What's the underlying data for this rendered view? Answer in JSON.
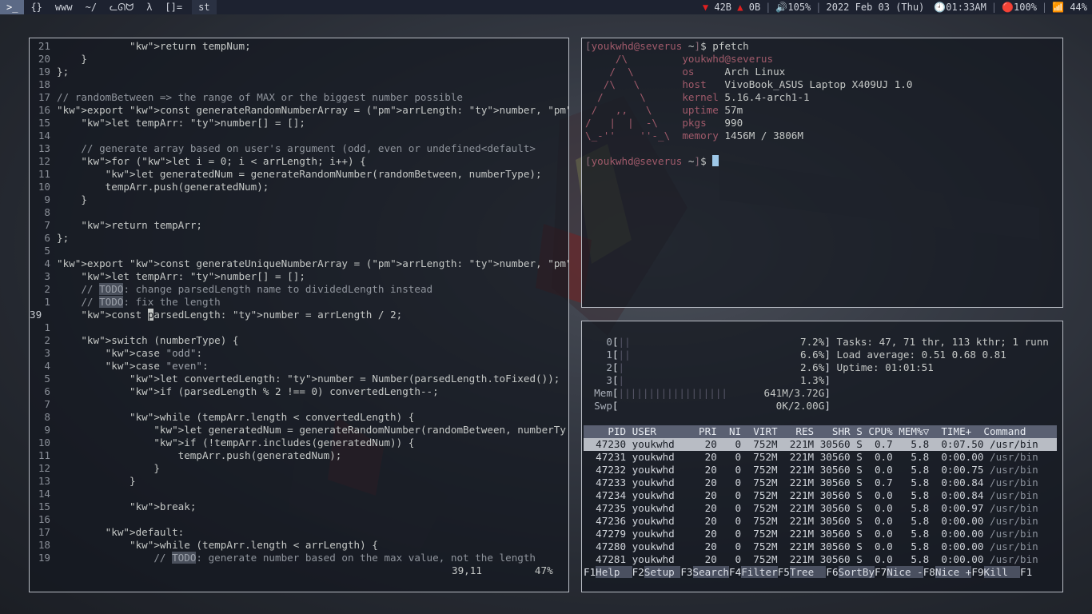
{
  "bar": {
    "launcher": ">_",
    "tags": [
      "{}",
      "www",
      "~/",
      "ᓚᘏᗢ",
      "λ",
      "[]="
    ],
    "window_title": "st",
    "net_down": "42B",
    "net_up": "0B",
    "volume": "🔊105%",
    "date": "2022 Feb 03 (Thu)",
    "time": "🕘01:33AM",
    "battery": "🔴100%",
    "wifi": "📶 44%"
  },
  "editor": {
    "lines": [
      {
        "n": "21",
        "t": "            return tempNum;"
      },
      {
        "n": "20",
        "t": "    }"
      },
      {
        "n": "19",
        "t": "};"
      },
      {
        "n": "18",
        "t": ""
      },
      {
        "n": "17",
        "t": "// randomBetween => the range of MAX or the biggest number possible"
      },
      {
        "n": "16",
        "t": "export const generateRandomNumberArray = (arrLength: number, randomBetween: num"
      },
      {
        "n": "15",
        "t": "    let tempArr: number[] = [];"
      },
      {
        "n": "14",
        "t": ""
      },
      {
        "n": "13",
        "t": "    // generate array based on user's argument (odd, even or undefined<default>"
      },
      {
        "n": "12",
        "t": "    for (let i = 0; i < arrLength; i++) {"
      },
      {
        "n": "11",
        "t": "        let generatedNum = generateRandomNumber(randomBetween, numberType);"
      },
      {
        "n": "10",
        "t": "        tempArr.push(generatedNum);"
      },
      {
        "n": "9",
        "t": "    }"
      },
      {
        "n": "8",
        "t": ""
      },
      {
        "n": "7",
        "t": "    return tempArr;"
      },
      {
        "n": "6",
        "t": "};"
      },
      {
        "n": "5",
        "t": ""
      },
      {
        "n": "4",
        "t": "export const generateUniqueNumberArray = (arrLength: number, randomBetween: num"
      },
      {
        "n": "3",
        "t": "    let tempArr: number[] = [];"
      },
      {
        "n": "2",
        "t": "    // TODO: change parsedLength name to dividedLength instead"
      },
      {
        "n": "1",
        "t": "    // TODO: fix the length"
      },
      {
        "n": "39",
        "t": "    const parsedLength: number = arrLength / 2;"
      },
      {
        "n": "1",
        "t": ""
      },
      {
        "n": "2",
        "t": "    switch (numberType) {"
      },
      {
        "n": "3",
        "t": "        case \"odd\":"
      },
      {
        "n": "4",
        "t": "        case \"even\":"
      },
      {
        "n": "5",
        "t": "            let convertedLength: number = Number(parsedLength.toFixed());"
      },
      {
        "n": "6",
        "t": "            if (parsedLength % 2 !== 0) convertedLength--;"
      },
      {
        "n": "7",
        "t": ""
      },
      {
        "n": "8",
        "t": "            while (tempArr.length < convertedLength) {"
      },
      {
        "n": "9",
        "t": "                let generatedNum = generateRandomNumber(randomBetween, numberTy"
      },
      {
        "n": "10",
        "t": "                if (!tempArr.includes(generatedNum)) {"
      },
      {
        "n": "11",
        "t": "                    tempArr.push(generatedNum);"
      },
      {
        "n": "12",
        "t": "                }"
      },
      {
        "n": "13",
        "t": "            }"
      },
      {
        "n": "14",
        "t": ""
      },
      {
        "n": "15",
        "t": "            break;"
      },
      {
        "n": "16",
        "t": ""
      },
      {
        "n": "17",
        "t": "        default:"
      },
      {
        "n": "18",
        "t": "            while (tempArr.length < arrLength) {"
      },
      {
        "n": "19",
        "t": "                // TODO: generate number based on the max value, not the length"
      }
    ],
    "status_pos": "39,11",
    "status_pct": "47%"
  },
  "term": {
    "prompt_user": "youkwhd@severus",
    "prompt_dir": "~",
    "cmd": "pfetch",
    "art": [
      "     /\\",
      "    /  \\",
      "   /\\   \\",
      "  /      \\",
      " /   ,,   \\",
      "/   |  |  -\\",
      "\\_-''    ''-_\\"
    ],
    "title": "youkwhd@severus",
    "info": [
      {
        "k": "os",
        "v": "Arch Linux"
      },
      {
        "k": "host",
        "v": "VivoBook_ASUS Laptop X409UJ 1.0"
      },
      {
        "k": "kernel",
        "v": "5.16.4-arch1-1"
      },
      {
        "k": "uptime",
        "v": "57m"
      },
      {
        "k": "pkgs",
        "v": "990"
      },
      {
        "k": "memory",
        "v": "1456M / 3806M"
      }
    ]
  },
  "htop": {
    "cpus": [
      {
        "id": "0",
        "pct": "7.2%",
        "fill": 0.072
      },
      {
        "id": "1",
        "pct": "6.6%",
        "fill": 0.066
      },
      {
        "id": "2",
        "pct": "2.6%",
        "fill": 0.026
      },
      {
        "id": "3",
        "pct": "1.3%",
        "fill": 0.013
      }
    ],
    "mem_label": "Mem",
    "mem_val": "641M/3.72G",
    "swp_label": "Swp",
    "swp_val": "0K/2.00G",
    "tasks": "Tasks: 47, 71 thr, 113 kthr; 1 runn",
    "load": "Load average: 0.51 0.68 0.81",
    "uptime": "Uptime: 01:01:51",
    "columns": "    PID USER       PRI  NI  VIRT   RES   SHR S CPU% MEM%▽  TIME+  Command",
    "procs": [
      {
        "pid": "47230",
        "user": "youkwhd",
        "pri": "20",
        "ni": "0",
        "virt": "752M",
        "res": "221M",
        "shr": "30560",
        "s": "S",
        "cpu": "0.7",
        "mem": "5.8",
        "time": "0:07.50",
        "cmd": "/usr/bin"
      },
      {
        "pid": "47231",
        "user": "youkwhd",
        "pri": "20",
        "ni": "0",
        "virt": "752M",
        "res": "221M",
        "shr": "30560",
        "s": "S",
        "cpu": "0.0",
        "mem": "5.8",
        "time": "0:00.00",
        "cmd": "/usr/bin"
      },
      {
        "pid": "47232",
        "user": "youkwhd",
        "pri": "20",
        "ni": "0",
        "virt": "752M",
        "res": "221M",
        "shr": "30560",
        "s": "S",
        "cpu": "0.0",
        "mem": "5.8",
        "time": "0:00.75",
        "cmd": "/usr/bin"
      },
      {
        "pid": "47233",
        "user": "youkwhd",
        "pri": "20",
        "ni": "0",
        "virt": "752M",
        "res": "221M",
        "shr": "30560",
        "s": "S",
        "cpu": "0.7",
        "mem": "5.8",
        "time": "0:00.84",
        "cmd": "/usr/bin"
      },
      {
        "pid": "47234",
        "user": "youkwhd",
        "pri": "20",
        "ni": "0",
        "virt": "752M",
        "res": "221M",
        "shr": "30560",
        "s": "S",
        "cpu": "0.0",
        "mem": "5.8",
        "time": "0:00.84",
        "cmd": "/usr/bin"
      },
      {
        "pid": "47235",
        "user": "youkwhd",
        "pri": "20",
        "ni": "0",
        "virt": "752M",
        "res": "221M",
        "shr": "30560",
        "s": "S",
        "cpu": "0.0",
        "mem": "5.8",
        "time": "0:00.97",
        "cmd": "/usr/bin"
      },
      {
        "pid": "47236",
        "user": "youkwhd",
        "pri": "20",
        "ni": "0",
        "virt": "752M",
        "res": "221M",
        "shr": "30560",
        "s": "S",
        "cpu": "0.0",
        "mem": "5.8",
        "time": "0:00.00",
        "cmd": "/usr/bin"
      },
      {
        "pid": "47279",
        "user": "youkwhd",
        "pri": "20",
        "ni": "0",
        "virt": "752M",
        "res": "221M",
        "shr": "30560",
        "s": "S",
        "cpu": "0.0",
        "mem": "5.8",
        "time": "0:00.00",
        "cmd": "/usr/bin"
      },
      {
        "pid": "47280",
        "user": "youkwhd",
        "pri": "20",
        "ni": "0",
        "virt": "752M",
        "res": "221M",
        "shr": "30560",
        "s": "S",
        "cpu": "0.0",
        "mem": "5.8",
        "time": "0:00.00",
        "cmd": "/usr/bin"
      },
      {
        "pid": "47281",
        "user": "youkwhd",
        "pri": "20",
        "ni": "0",
        "virt": "752M",
        "res": "221M",
        "shr": "30560",
        "s": "S",
        "cpu": "0.0",
        "mem": "5.8",
        "time": "0:00.00",
        "cmd": "/usr/bin"
      }
    ],
    "fkeys": [
      {
        "k": "F1",
        "l": "Help  "
      },
      {
        "k": "F2",
        "l": "Setup "
      },
      {
        "k": "F3",
        "l": "Search"
      },
      {
        "k": "F4",
        "l": "Filter"
      },
      {
        "k": "F5",
        "l": "Tree  "
      },
      {
        "k": "F6",
        "l": "SortBy"
      },
      {
        "k": "F7",
        "l": "Nice -"
      },
      {
        "k": "F8",
        "l": "Nice +"
      },
      {
        "k": "F9",
        "l": "Kill  "
      },
      {
        "k": "F1",
        "l": ""
      }
    ]
  }
}
